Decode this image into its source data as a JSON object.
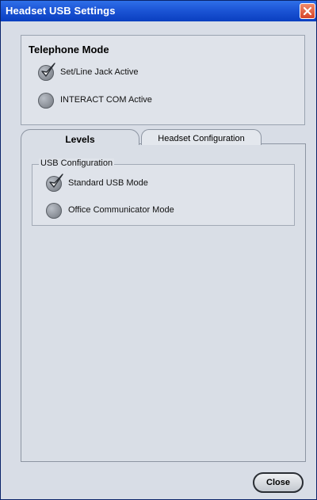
{
  "window": {
    "title": "Headset USB Settings"
  },
  "telephone_mode": {
    "title": "Telephone Mode",
    "options": [
      {
        "label": "Set/Line Jack Active",
        "selected": true
      },
      {
        "label": "INTERACT COM Active",
        "selected": false
      }
    ]
  },
  "tabs": [
    {
      "label": "Levels",
      "active": true
    },
    {
      "label": "Headset Configuration",
      "active": false
    }
  ],
  "usb_configuration": {
    "title": "USB Configuration",
    "options": [
      {
        "label": "Standard USB Mode",
        "selected": true
      },
      {
        "label": "Office Communicator Mode",
        "selected": false
      }
    ]
  },
  "footer": {
    "close_label": "Close"
  },
  "colors": {
    "titlebar": "#1c55d6",
    "panel": "#d9dee6",
    "close_x": "#d6442a"
  },
  "icons": {
    "selected": "checkmark-icon",
    "window_close": "close-icon"
  }
}
